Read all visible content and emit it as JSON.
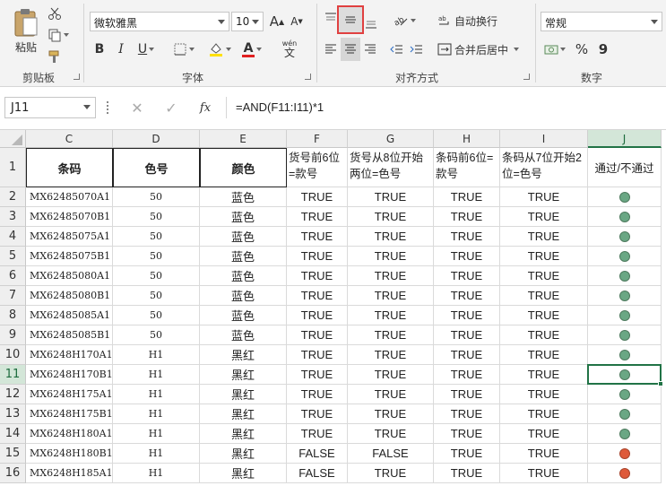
{
  "ribbon": {
    "clipboard": {
      "paste_label": "粘贴",
      "group_label": "剪贴板"
    },
    "font": {
      "font_name": "微软雅黑",
      "font_size": "10",
      "bold": "B",
      "italic": "I",
      "underline": "U",
      "grow": "A",
      "shrink": "A",
      "font_color_glyph": "A",
      "phonetic": "wén",
      "phonetic_glyph": "文",
      "group_label": "字体"
    },
    "alignment": {
      "wrap_text": "自动换行",
      "merge_center": "合并后居中",
      "group_label": "对齐方式"
    },
    "number": {
      "format": "常规",
      "percent": "%",
      "comma": "9",
      "group_label": "数字"
    }
  },
  "formula_bar": {
    "name_box": "J11",
    "fx": "fx",
    "formula": "=AND(F11:I11)*1"
  },
  "columns": [
    "C",
    "D",
    "E",
    "F",
    "G",
    "H",
    "I",
    "J"
  ],
  "selected_column": "J",
  "selected_row": 11,
  "header_row": {
    "row": "1",
    "C": "条码",
    "D": "色号",
    "E": "颜色",
    "F": "货号前6位=款号",
    "G": "货号从8位开始两位=色号",
    "H": "条码前6位=款号",
    "I": "条码从7位开始2位=色号",
    "J": "通过/不通过"
  },
  "rows": [
    {
      "row": "2",
      "C": "MX62485070A1",
      "D": "50",
      "E": "蓝色",
      "F": "TRUE",
      "G": "TRUE",
      "H": "TRUE",
      "I": "TRUE",
      "J": "pass"
    },
    {
      "row": "3",
      "C": "MX62485070B1",
      "D": "50",
      "E": "蓝色",
      "F": "TRUE",
      "G": "TRUE",
      "H": "TRUE",
      "I": "TRUE",
      "J": "pass"
    },
    {
      "row": "4",
      "C": "MX62485075A1",
      "D": "50",
      "E": "蓝色",
      "F": "TRUE",
      "G": "TRUE",
      "H": "TRUE",
      "I": "TRUE",
      "J": "pass"
    },
    {
      "row": "5",
      "C": "MX62485075B1",
      "D": "50",
      "E": "蓝色",
      "F": "TRUE",
      "G": "TRUE",
      "H": "TRUE",
      "I": "TRUE",
      "J": "pass"
    },
    {
      "row": "6",
      "C": "MX62485080A1",
      "D": "50",
      "E": "蓝色",
      "F": "TRUE",
      "G": "TRUE",
      "H": "TRUE",
      "I": "TRUE",
      "J": "pass"
    },
    {
      "row": "7",
      "C": "MX62485080B1",
      "D": "50",
      "E": "蓝色",
      "F": "TRUE",
      "G": "TRUE",
      "H": "TRUE",
      "I": "TRUE",
      "J": "pass"
    },
    {
      "row": "8",
      "C": "MX62485085A1",
      "D": "50",
      "E": "蓝色",
      "F": "TRUE",
      "G": "TRUE",
      "H": "TRUE",
      "I": "TRUE",
      "J": "pass"
    },
    {
      "row": "9",
      "C": "MX62485085B1",
      "D": "50",
      "E": "蓝色",
      "F": "TRUE",
      "G": "TRUE",
      "H": "TRUE",
      "I": "TRUE",
      "J": "pass"
    },
    {
      "row": "10",
      "C": "MX6248H170A1",
      "D": "H1",
      "E": "黑红",
      "F": "TRUE",
      "G": "TRUE",
      "H": "TRUE",
      "I": "TRUE",
      "J": "pass"
    },
    {
      "row": "11",
      "C": "MX6248H170B1",
      "D": "H1",
      "E": "黑红",
      "F": "TRUE",
      "G": "TRUE",
      "H": "TRUE",
      "I": "TRUE",
      "J": "pass"
    },
    {
      "row": "12",
      "C": "MX6248H175A1",
      "D": "H1",
      "E": "黑红",
      "F": "TRUE",
      "G": "TRUE",
      "H": "TRUE",
      "I": "TRUE",
      "J": "pass"
    },
    {
      "row": "13",
      "C": "MX6248H175B1",
      "D": "H1",
      "E": "黑红",
      "F": "TRUE",
      "G": "TRUE",
      "H": "TRUE",
      "I": "TRUE",
      "J": "pass"
    },
    {
      "row": "14",
      "C": "MX6248H180A1",
      "D": "H1",
      "E": "黑红",
      "F": "TRUE",
      "G": "TRUE",
      "H": "TRUE",
      "I": "TRUE",
      "J": "pass"
    },
    {
      "row": "15",
      "C": "MX6248H180B1",
      "D": "H1",
      "E": "黑红",
      "F": "FALSE",
      "G": "FALSE",
      "H": "TRUE",
      "I": "TRUE",
      "J": "fail"
    },
    {
      "row": "16",
      "C": "MX6248H185A1",
      "D": "H1",
      "E": "黑红",
      "F": "FALSE",
      "G": "TRUE",
      "H": "TRUE",
      "I": "TRUE",
      "J": "fail"
    }
  ],
  "colors": {
    "pass": "#6aa784",
    "fail": "#de5a3a",
    "accent": "#217346",
    "highlight_box": "#e04040"
  }
}
